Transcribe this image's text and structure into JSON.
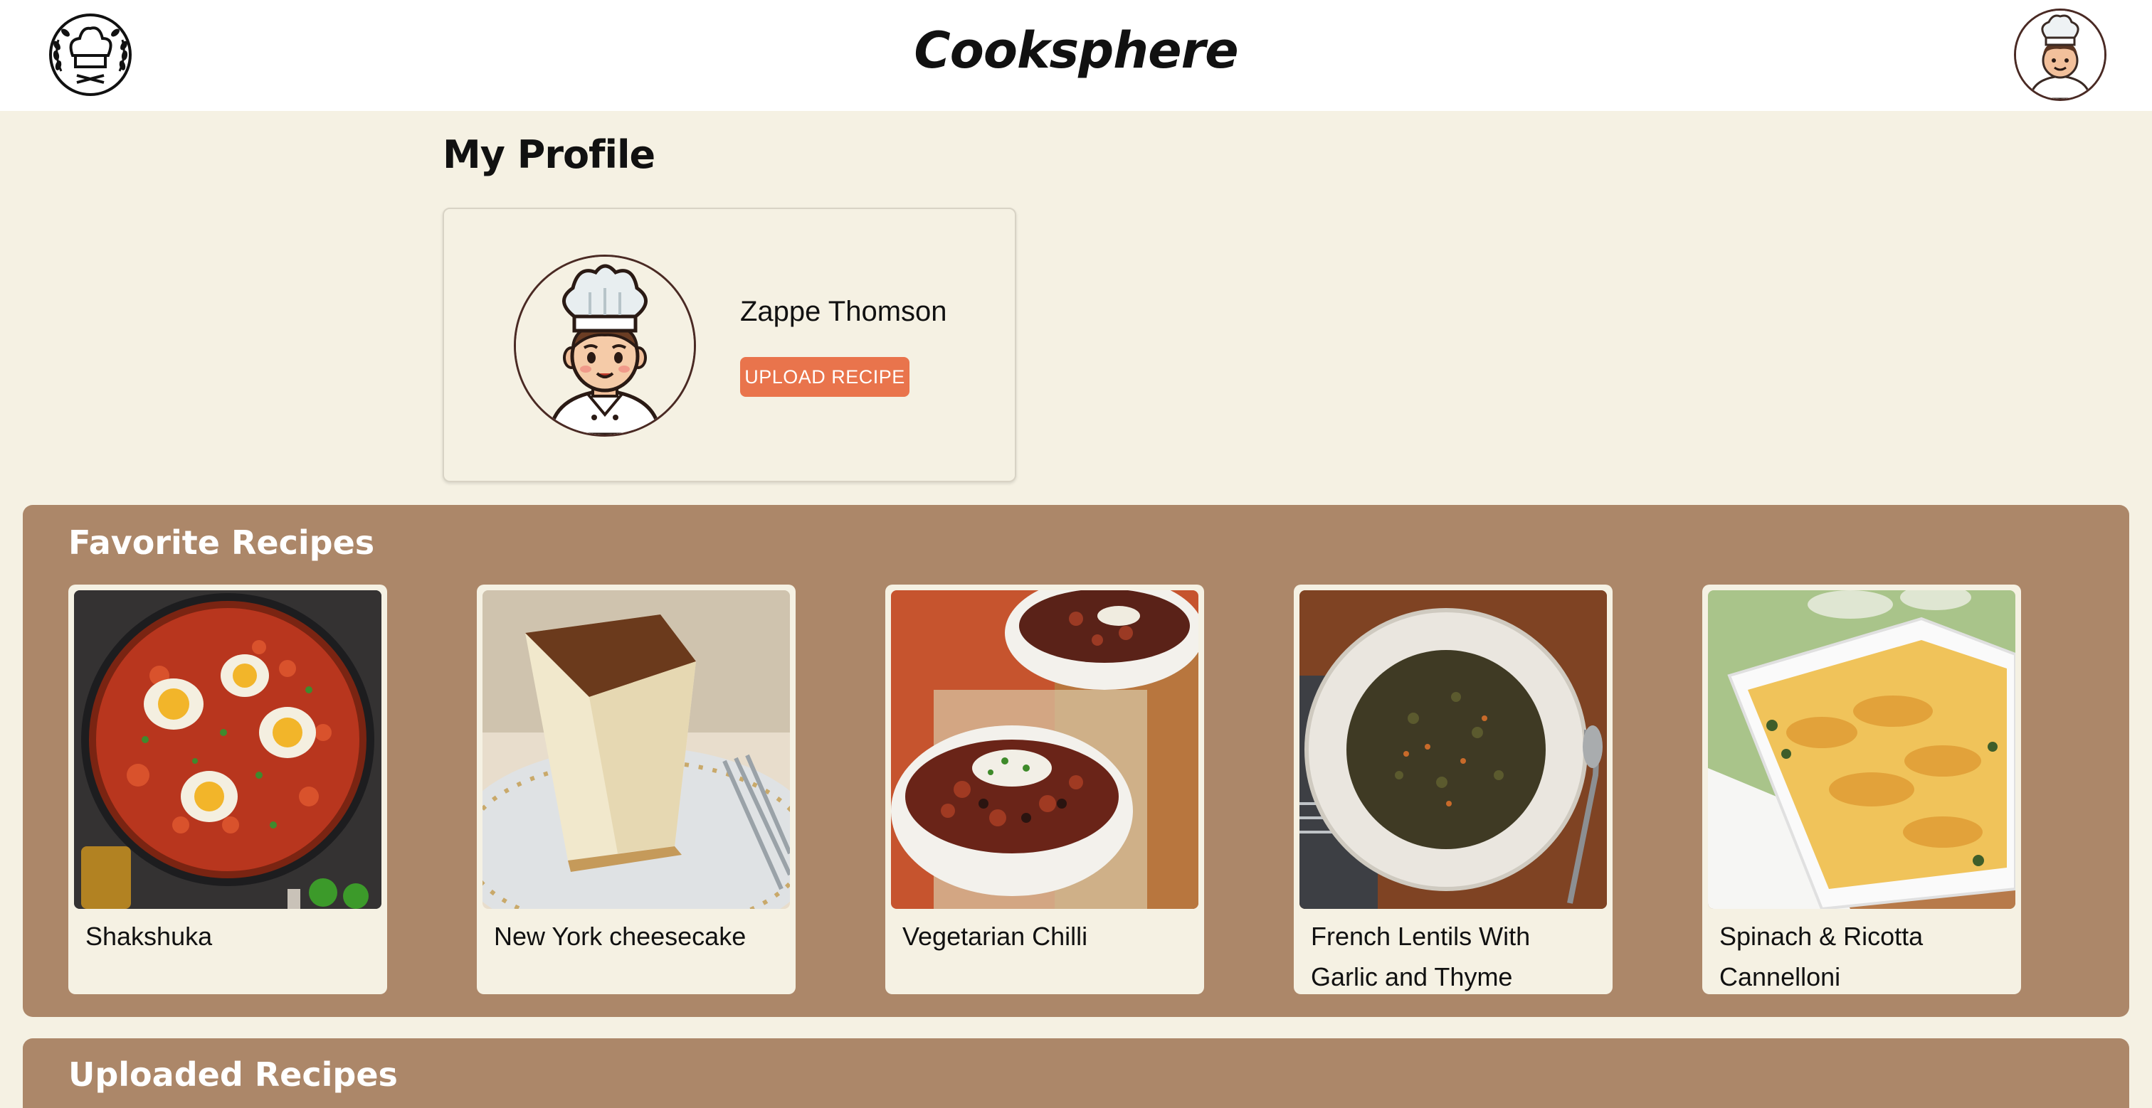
{
  "header": {
    "app_title": "Cooksphere",
    "logo_icon": "chef-hat-logo-icon",
    "avatar_icon": "chef-avatar-icon"
  },
  "page": {
    "title": "My Profile"
  },
  "profile": {
    "name": "Zappe Thomson",
    "upload_label": "UPLOAD RECIPE",
    "avatar_icon": "chef-avatar-icon"
  },
  "favorites": {
    "title": "Favorite Recipes",
    "recipes": [
      {
        "name": "Shakshuka"
      },
      {
        "name": "New York cheesecake"
      },
      {
        "name": "Vegetarian Chilli"
      },
      {
        "name": "French Lentils With Garlic and Thyme"
      },
      {
        "name": "Spinach & Ricotta Cannelloni"
      }
    ]
  },
  "uploaded": {
    "title": "Uploaded Recipes"
  },
  "colors": {
    "page_bg": "#f5f1e3",
    "section_bg": "#ac8769",
    "accent": "#e9744c",
    "avatar_border": "#4a2a24"
  }
}
